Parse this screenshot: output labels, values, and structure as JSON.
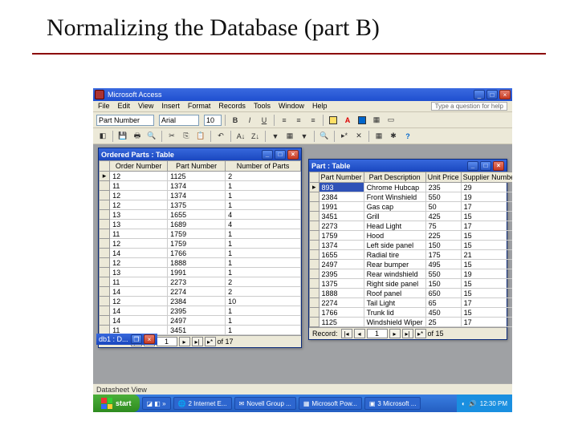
{
  "slide_title": "Normalizing the Database (part B)",
  "app_title": "Microsoft Access",
  "menu": [
    "File",
    "Edit",
    "View",
    "Insert",
    "Format",
    "Records",
    "Tools",
    "Window",
    "Help"
  ],
  "help_placeholder": "Type a question for help",
  "font_field": "Part Number",
  "font_name": "Arial",
  "font_size": "10",
  "win1": {
    "title": "Ordered Parts : Table",
    "cols": [
      "Order Number",
      "Part Number",
      "Number of Parts"
    ],
    "rows": [
      [
        "12",
        "1125",
        "2"
      ],
      [
        "11",
        "1374",
        "1"
      ],
      [
        "12",
        "1374",
        "1"
      ],
      [
        "12",
        "1375",
        "1"
      ],
      [
        "13",
        "1655",
        "4"
      ],
      [
        "13",
        "1689",
        "4"
      ],
      [
        "11",
        "1759",
        "1"
      ],
      [
        "12",
        "1759",
        "1"
      ],
      [
        "14",
        "1766",
        "1"
      ],
      [
        "12",
        "1888",
        "1"
      ],
      [
        "13",
        "1991",
        "1"
      ],
      [
        "11",
        "2273",
        "2"
      ],
      [
        "14",
        "2274",
        "2"
      ],
      [
        "12",
        "2384",
        "10"
      ],
      [
        "14",
        "2395",
        "1"
      ],
      [
        "14",
        "2497",
        "1"
      ],
      [
        "11",
        "3451",
        "1"
      ]
    ],
    "nav_of": "of  17",
    "nav_cur": "1",
    "nav_label": "Record:"
  },
  "win2": {
    "title": "Part : Table",
    "cols": [
      "Part Number",
      "Part Description",
      "Unit Price",
      "Supplier Number"
    ],
    "rows": [
      [
        "893",
        "Chrome Hubcap",
        "235",
        "29"
      ],
      [
        "2384",
        "Front Winshield",
        "550",
        "19"
      ],
      [
        "1991",
        "Gas cap",
        "50",
        "17"
      ],
      [
        "3451",
        "Grill",
        "425",
        "15"
      ],
      [
        "2273",
        "Head Light",
        "75",
        "17"
      ],
      [
        "1759",
        "Hood",
        "225",
        "15"
      ],
      [
        "1374",
        "Left side panel",
        "150",
        "15"
      ],
      [
        "1655",
        "Radial tire",
        "175",
        "21"
      ],
      [
        "2497",
        "Rear bumper",
        "495",
        "15"
      ],
      [
        "2395",
        "Rear windshield",
        "550",
        "19"
      ],
      [
        "1375",
        "Right side panel",
        "150",
        "15"
      ],
      [
        "1888",
        "Roof panel",
        "650",
        "15"
      ],
      [
        "2274",
        "Tail Light",
        "65",
        "17"
      ],
      [
        "1766",
        "Trunk lid",
        "450",
        "15"
      ],
      [
        "1125",
        "Windshield Wiper",
        "25",
        "17"
      ]
    ],
    "nav_of": "of  15",
    "nav_cur": "1",
    "nav_label": "Record:"
  },
  "db_mini": "db1 : D...",
  "statusbar": "Datasheet View",
  "taskbar": {
    "start": "start",
    "tasks": [
      "2 Internet E...",
      "Novell Group ...",
      "Microsoft Pow...",
      "3 Microsoft ..."
    ],
    "time": "12:30 PM"
  }
}
